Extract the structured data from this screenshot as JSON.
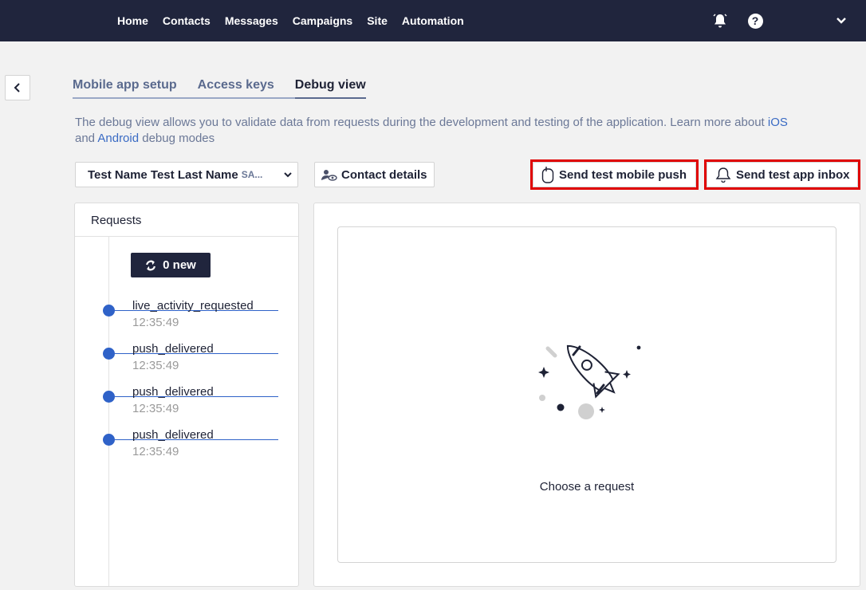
{
  "nav": {
    "items": [
      "Home",
      "Contacts",
      "Messages",
      "Campaigns",
      "Site",
      "Automation"
    ],
    "bell_icon": "bell-icon",
    "help_icon": "help-icon",
    "help_glyph": "?",
    "account_icon": "chevron-down-icon"
  },
  "tabs": [
    {
      "label": "Mobile app setup",
      "active": false
    },
    {
      "label": "Access keys",
      "active": false
    },
    {
      "label": "Debug view",
      "active": true
    }
  ],
  "description": {
    "text_before": "The debug view allows you to validate data from requests during the development and testing of the application. Learn more about ",
    "ios_link": "iOS",
    "text_and": " and ",
    "android_link": "Android",
    "text_after": " debug modes"
  },
  "contact_select": {
    "name": "Test Name Test Last Name",
    "sub": "SA..."
  },
  "buttons": {
    "contact_details": "Contact details",
    "send_push": "Send test mobile push",
    "send_inbox": "Send test app inbox"
  },
  "requests": {
    "title": "Requests",
    "new_button": "0 new",
    "items": [
      {
        "name": "live_activity_requested",
        "time": "12:35:49"
      },
      {
        "name": "push_delivered",
        "time": "12:35:49"
      },
      {
        "name": "push_delivered",
        "time": "12:35:49"
      },
      {
        "name": "push_delivered",
        "time": "12:35:49"
      }
    ]
  },
  "detail": {
    "empty_text": "Choose a request",
    "illustration": "rocket-illustration"
  },
  "colors": {
    "nav_bg": "#20253d",
    "accent": "#2f62c8",
    "highlight": "#e00000"
  }
}
